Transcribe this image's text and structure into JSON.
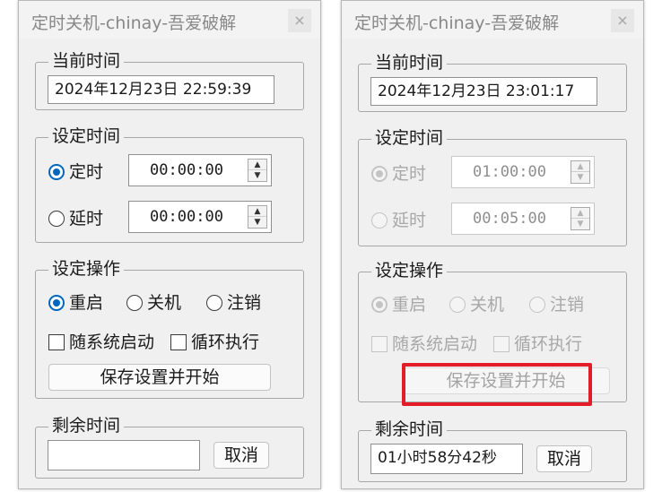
{
  "left": {
    "title": "定时关机-chinay-吾爱破解",
    "close_label": "×",
    "current_time": {
      "legend": "当前时间",
      "value": "2024年12月23日  22:59:39"
    },
    "set_time": {
      "legend": "设定时间",
      "timed": {
        "label": "定时",
        "value": "00:00:00",
        "checked": true
      },
      "delay": {
        "label": "延时",
        "value": "00:00:00",
        "checked": false
      }
    },
    "operation": {
      "legend": "设定操作",
      "restart": "重启",
      "shutdown": "关机",
      "logoff": "注销",
      "autostart": "随系统启动",
      "loop": "循环执行",
      "start_button": "保存设置并开始"
    },
    "remaining": {
      "legend": "剩余时间",
      "value": "",
      "cancel": "取消"
    }
  },
  "right": {
    "title": "定时关机-chinay-吾爱破解",
    "close_label": "×",
    "current_time": {
      "legend": "当前时间",
      "value": "2024年12月23日  23:01:17"
    },
    "set_time": {
      "legend": "设定时间",
      "timed": {
        "label": "定时",
        "value": "01:00:00",
        "checked": true
      },
      "delay": {
        "label": "延时",
        "value": "00:05:00",
        "checked": false
      }
    },
    "operation": {
      "legend": "设定操作",
      "restart": "重启",
      "shutdown": "关机",
      "logoff": "注销",
      "autostart": "随系统启动",
      "loop": "循环执行",
      "start_button": "保存设置并开始"
    },
    "remaining": {
      "legend": "剩余时间",
      "value": "01小时58分42秒",
      "cancel": "取消"
    }
  },
  "icons": {
    "spin_up": "▲",
    "spin_down": "▼"
  },
  "colors": {
    "accent": "#0067c0",
    "highlight": "#e41c2a",
    "disabled_text": "#a8a8a8"
  }
}
